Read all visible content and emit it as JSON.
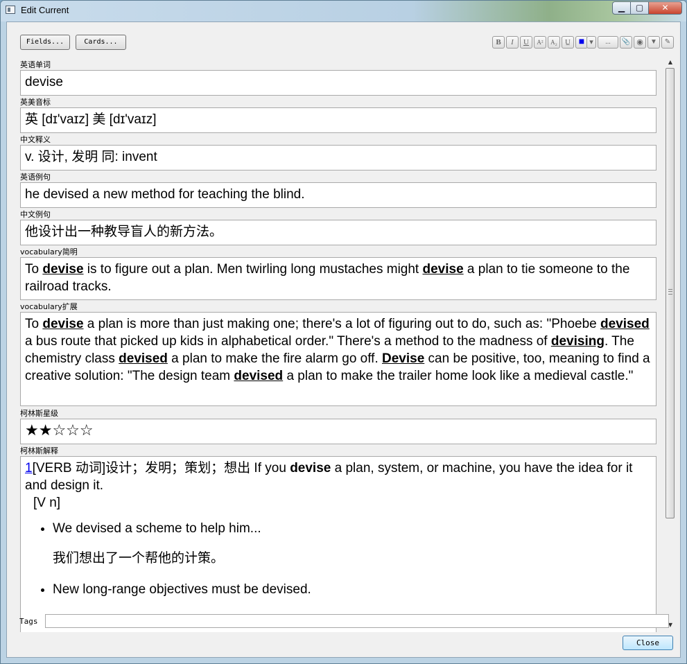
{
  "window": {
    "title": "Edit Current",
    "min_label": "▁",
    "max_label": "▢",
    "close_label": "✕"
  },
  "toolbar": {
    "fields_label": "Fields...",
    "cards_label": "Cards...",
    "format_buttons": [
      "B",
      "I",
      "U",
      "A²",
      "A₂",
      "U̲",
      "■",
      "▾",
      "...",
      "📎",
      "◉",
      "▼",
      "✎"
    ]
  },
  "fields": [
    {
      "label": "英语单词",
      "value": "devise"
    },
    {
      "label": "英美音标",
      "value": "英 [dɪ'vaɪz] 美 [dɪ'vaɪz]"
    },
    {
      "label": "中文释义",
      "value": "v. 设计, 发明 同: invent"
    },
    {
      "label": "英语例句",
      "value": "he devised a new method for teaching the blind."
    },
    {
      "label": "中文例句",
      "value": "他设计出一种教导盲人的新方法。"
    },
    {
      "label": "vocabulary简明",
      "parts": [
        "To ",
        "devise",
        " is to figure out a plan. Men twirling long mustaches might ",
        "devise",
        " a plan to tie someone to the railroad tracks."
      ]
    },
    {
      "label": "vocabulary扩展",
      "parts": [
        "To ",
        "devise",
        " a plan is more than just making one; there's a lot of figuring out to do, such as: \"Phoebe ",
        "devised",
        " a bus route that picked up kids in alphabetical order.\" There's a method to the madness of ",
        "devising",
        ". The chemistry class ",
        "devised",
        " a plan to make the fire alarm go off. ",
        "Devise",
        " can be positive, too, meaning to find a creative solution: \"The design team ",
        "devised",
        " a plan to make the trailer home look like a medieval castle.\""
      ]
    },
    {
      "label": "柯林斯星级",
      "value": "★★☆☆☆"
    },
    {
      "label": "柯林斯解释",
      "sense_num": "1",
      "sense_head": "[VERB 动词]设计；发明；策划；想出 If you ",
      "sense_bold": "devise",
      "sense_tail": " a plan, system, or machine, you have the idea for it and design it.",
      "pattern": "[V n]",
      "examples": [
        {
          "en": "We devised a scheme to help him...",
          "zh": "我们想出了一个帮他的计策。"
        },
        {
          "en": "New long-range objectives must be devised."
        }
      ]
    }
  ],
  "tags": {
    "label": "Tags",
    "value": ""
  },
  "close_label": "Close"
}
